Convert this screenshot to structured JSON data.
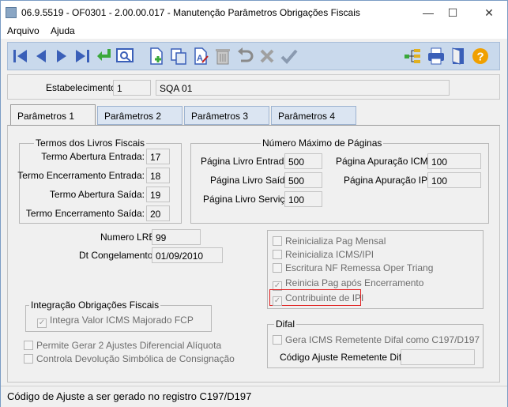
{
  "window": {
    "title": "06.9.5519 - OF0301 - 2.00.00.017 - Manutenção Parâmetros Obrigações Fiscais",
    "minimize": "—",
    "maximize": "☐",
    "close": "✕"
  },
  "menu": {
    "arquivo": "Arquivo",
    "ajuda": "Ajuda"
  },
  "toolbar_icons": [
    "first-icon",
    "prev-icon",
    "next-icon",
    "last-icon",
    "goto-icon",
    "search-icon",
    "new-icon",
    "copy-icon",
    "edit-icon",
    "delete-icon",
    "undo-icon",
    "cancel-icon",
    "save-icon",
    "tree-icon",
    "print-icon",
    "exit-icon",
    "help-icon"
  ],
  "header": {
    "estab_label": "Estabelecimento:",
    "estab_code": "1",
    "estab_name": "SQA 01"
  },
  "tabs": [
    {
      "label": "Parâmetros 1"
    },
    {
      "label": "Parâmetros 2"
    },
    {
      "label": "Parâmetros 3"
    },
    {
      "label": "Parâmetros 4"
    }
  ],
  "termos": {
    "title": "Termos dos Livros Fiscais",
    "abertura_entrada_label": "Termo Abertura Entrada:",
    "abertura_entrada": "17",
    "encerramento_entrada_label": "Termo Encerramento Entrada:",
    "encerramento_entrada": "18",
    "abertura_saida_label": "Termo Abertura Saída:",
    "abertura_saida": "19",
    "encerramento_saida_label": "Termo Encerramento Saída:",
    "encerramento_saida": "20"
  },
  "paginas": {
    "title": "Número Máximo de Páginas",
    "livro_entrada_label": "Página Livro Entrada:",
    "livro_entrada": "500",
    "livro_saida_label": "Página Livro Saída:",
    "livro_saida": "500",
    "livro_servico_label": "Página Livro Serviço:",
    "livro_servico": "100",
    "apuracao_icms_label": "Página  Apuração ICMS:",
    "apuracao_icms": "100",
    "apuracao_ipi_label": "Página  Apuração IPI:",
    "apuracao_ipi": "100"
  },
  "numero_lre_label": "Numero LRE:",
  "numero_lre": "99",
  "dt_congelamento_label": "Dt Congelamento:",
  "dt_congelamento": "01/09/2010",
  "options": {
    "reinicializa_pag_mensal": "Reinicializa Pag Mensal",
    "reinicializa_icms_ipi": "Reinicializa ICMS/IPI",
    "escritura_nf": "Escritura NF Remessa Oper Triang",
    "reinicia_pag": "Reinicia Pag após Encerramento",
    "contribuinte_ipi": "Contribuinte de IPI"
  },
  "integracao": {
    "title": "Integração Obrigações Fiscais",
    "integra_valor": "Integra Valor ICMS Majorado FCP"
  },
  "permite_gerar": "Permite Gerar 2 Ajustes Diferencial Alíquota",
  "controla_devolucao": "Controla Devolução Simbólica de Consignação",
  "difal": {
    "title": "Difal",
    "gera_icms": "Gera ICMS Remetente Difal como C197/D197",
    "codigo_label": "Código Ajuste Remetente Difal:",
    "codigo": ""
  },
  "status_text": "Código de Ajuste a ser gerado no registro C197/D197",
  "colors": {
    "toolbar_bg": "#c9d9ec",
    "tab_bg": "#dbe5f2",
    "highlight": "#e02020"
  }
}
